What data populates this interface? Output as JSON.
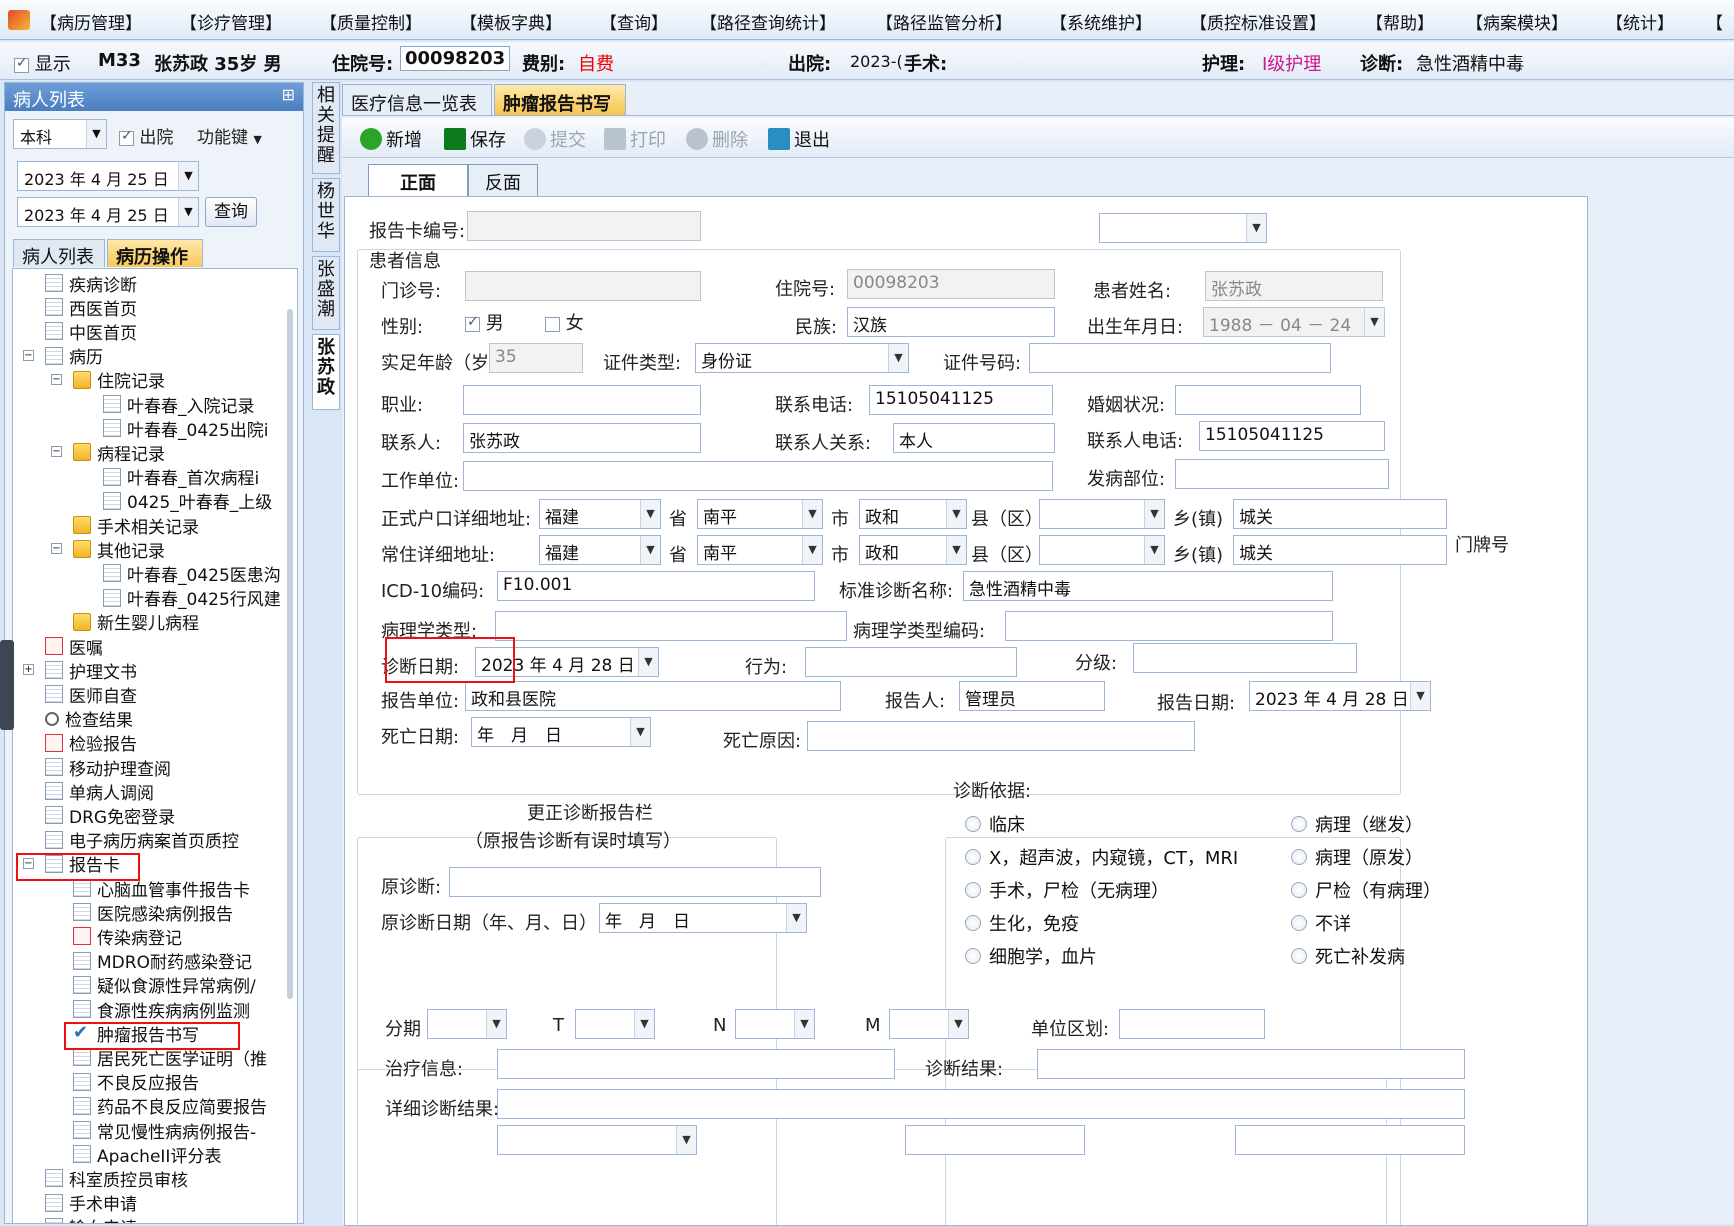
{
  "menu": [
    "【病历管理】",
    "【诊疗管理】",
    "【质量控制】",
    "【模板字典】",
    "【查询】",
    "【路径查询统计】",
    "【路径监管分析】",
    "【系统维护】",
    "【质控标准设置】",
    "【帮助】",
    "【病案模块】",
    "【统计】",
    "【"
  ],
  "infobar": {
    "show": "显示",
    "bed": "M33",
    "patient": "张苏政 35岁 男",
    "admission_label": "住院号:",
    "admission_no": "00098203",
    "fee_label": "费别:",
    "fee": "自费",
    "discharge_label": "出院:",
    "discharge": "2023-(",
    "surgery_label": "手术:",
    "nursing_label": "护理:",
    "nursing": "Ⅰ级护理",
    "diag_label": "诊断:",
    "diagnosis": "急性酒精中毒"
  },
  "left": {
    "panel_title": "病人列表",
    "pin": "⊞",
    "dept": "本科",
    "discharged": "出院",
    "function_key": "功能键",
    "date1": "2023 年 4 月 25 日",
    "date2": "2023 年 4 月 25 日",
    "query": "查询",
    "tab_list": "病人列表",
    "tab_ops": "病历操作"
  },
  "tree": [
    "疾病诊断",
    "西医首页",
    "中医首页",
    "病历",
    "住院记录",
    "叶春春_入院记录",
    "叶春春_0425出院i",
    "病程记录",
    "叶春春_首次病程i",
    "0425_叶春春_上级",
    "手术相关记录",
    "其他记录",
    "叶春春_0425医患沟",
    "叶春春_0425行风建",
    "新生婴儿病程",
    "医嘱",
    "护理文书",
    "医师自查",
    "检查结果",
    "检验报告",
    "移动护理查阅",
    "单病人调阅",
    "DRG免密登录",
    "电子病历病案首页质控",
    "报告卡",
    "心脑血管事件报告卡",
    "医院感染病例报告",
    "传染病登记",
    "MDRO耐药感染登记",
    "疑似食源性异常病例/",
    "食源性疾病病例监测",
    "肿瘤报告书写",
    "居民死亡医学证明（推",
    "不良反应报告",
    "药品不良反应简要报告",
    "常见慢性病病例报告-",
    "ApacheII评分表",
    "科室质控员审核",
    "手术申请",
    "输血申请"
  ],
  "vtabs": [
    "相关提醒",
    "杨世华",
    "张盛潮",
    "张苏政"
  ],
  "main": {
    "tabs": [
      "医疗信息一览表",
      "肿瘤报告书写"
    ],
    "toolbar": [
      "新增",
      "保存",
      "提交",
      "打印",
      "删除",
      "退出"
    ],
    "pages": [
      "正面",
      "反面"
    ]
  },
  "form": {
    "card_no": "报告卡编号:",
    "patient_info": "患者信息",
    "outpatient": "门诊号:",
    "inpatient": "住院号:",
    "inpatient_val": "00098203",
    "name": "患者姓名:",
    "name_val": "张苏政",
    "sex": "性别:",
    "male": "男",
    "female": "女",
    "ethnic": "民族:",
    "ethnic_val": "汉族",
    "birth": "出生年月日:",
    "birth_val": "1988 － 04 － 24",
    "age": "实足年龄（岁）",
    "age_val": "35",
    "idtype": "证件类型:",
    "idtype_val": "身份证",
    "idno": "证件号码:",
    "job": "职业:",
    "phone": "联系电话:",
    "phone_val": "15105041125",
    "marital": "婚姻状况:",
    "contact": "联系人:",
    "contact_val": "张苏政",
    "relation": "联系人关系:",
    "relation_val": "本人",
    "cphone": "联系人电话:",
    "cphone_val": "15105041125",
    "work": "工作单位:",
    "site": "发病部位:",
    "hukou": "正式户口详细地址:",
    "resid": "常住详细地址:",
    "prov_val": "福建",
    "prov": "省",
    "city_val": "南平",
    "city": "市",
    "county_val": "政和",
    "county": "县（区）",
    "town": "乡(镇)",
    "town_val": "城关",
    "door": "门牌号",
    "icd": "ICD-10编码:",
    "icd_val": "F10.001",
    "stddiag": "标准诊断名称:",
    "stddiag_val": "急性酒精中毒",
    "path": "病理学类型:",
    "pathcode": "病理学类型编码:",
    "diagdate": "诊断日期:",
    "diagdate_val": "2023 年 4 月 28 日",
    "behavior": "行为:",
    "grade": "分级:",
    "unit": "报告单位:",
    "unit_val": "政和县医院",
    "reporter": "报告人:",
    "reporter_val": "管理员",
    "rdate": "报告日期:",
    "rdate_val": "2023 年 4 月 28 日",
    "death": "死亡日期:",
    "blankdate": "年　月　日",
    "deathcause": "死亡原因:",
    "correct1": "更正诊断报告栏",
    "correct2": "（原报告诊断有误时填写）",
    "orig": "原诊断:",
    "origdate": "原诊断日期（年、月、日）:",
    "basis": "诊断依据:",
    "radios_l": [
      "临床",
      "X，超声波，内窥镜，CT，MRI",
      "手术，尸检（无病理）",
      "生化，免疫",
      "细胞学，血片"
    ],
    "radios_r": [
      "病理（继发）",
      "病理（原发）",
      "尸检（有病理）",
      "不详",
      "死亡补发病"
    ],
    "stage": "分期",
    "t": "T",
    "n": "N",
    "m": "M",
    "region": "单位区划:",
    "treat": "治疗信息:",
    "result": "诊断结果:",
    "detail": "详细诊断结果:"
  }
}
